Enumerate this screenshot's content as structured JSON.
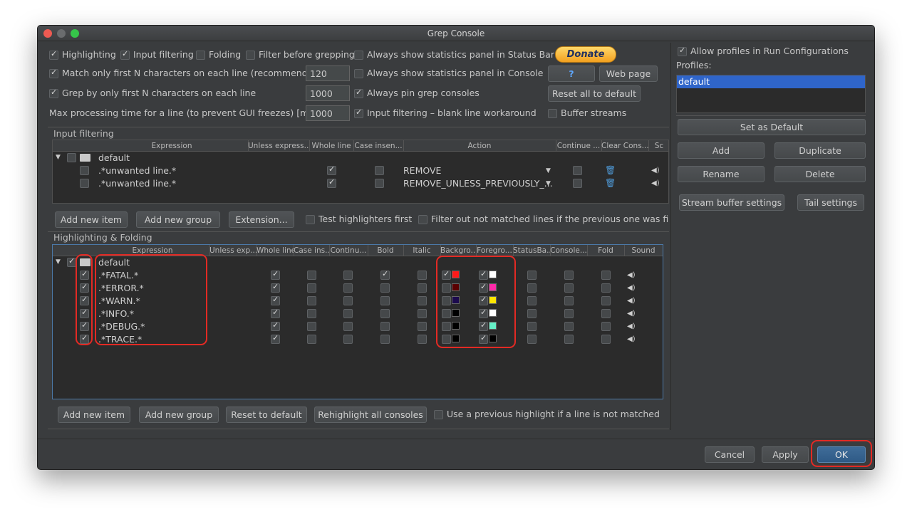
{
  "window": {
    "title": "Grep Console"
  },
  "top_options": {
    "highlighting": {
      "label": "Highlighting",
      "checked": true
    },
    "input_filtering": {
      "label": "Input filtering",
      "checked": true
    },
    "folding": {
      "label": "Folding",
      "checked": false
    },
    "filter_before_grepping": {
      "label": "Filter before grepping",
      "checked": false
    },
    "stats_status_bar": {
      "label": "Always show statistics panel in Status Bar",
      "checked": false
    },
    "match_first_n": {
      "label": "Match only first N characters on each line (recommended)",
      "checked": true,
      "value": "120"
    },
    "stats_console": {
      "label": "Always show statistics panel in Console",
      "checked": false
    },
    "grep_first_n": {
      "label": "Grep by only first N characters on each line",
      "checked": true,
      "value": "1000"
    },
    "pin_consoles": {
      "label": "Always pin grep consoles",
      "checked": true
    },
    "max_processing": {
      "label": "Max processing time for a line (to prevent GUI freezes) [ms]",
      "value": "1000"
    },
    "blank_line_workaround": {
      "label": "Input filtering – blank line workaround",
      "checked": true
    },
    "buffer_streams": {
      "label": "Buffer streams",
      "checked": false
    }
  },
  "buttons": {
    "donate": "Donate",
    "help": "?",
    "web_page": "Web page",
    "reset_all": "Reset all to default"
  },
  "input_filtering": {
    "title": "Input filtering",
    "headers": [
      "Expression",
      "Unless express...",
      "Whole line",
      "Case insen...",
      "Action",
      "Continue ...",
      "Clear Cons...",
      "Sc"
    ],
    "group": "default",
    "rows": [
      {
        "expression": ".*unwanted line.*",
        "whole_line": true,
        "case_insensitive": false,
        "action": "REMOVE",
        "continue": false
      },
      {
        "expression": ".*unwanted line.*",
        "whole_line": true,
        "case_insensitive": false,
        "action": "REMOVE_UNLESS_PREVIOUSLY_...",
        "continue": false
      }
    ],
    "add_item": "Add new item",
    "add_group": "Add new group",
    "extension": "Extension...",
    "test_highlighters": "Test highlighters first",
    "filter_out": "Filter out not matched lines if the previous one was filte"
  },
  "highlighting": {
    "title": "Highlighting & Folding",
    "headers": [
      "Expression",
      "Unless exp...",
      "Whole line",
      "Case ins...",
      "Continu...",
      "Bold",
      "Italic",
      "Backgro...",
      "Foregro...",
      "StatusBa...",
      "Console...",
      "Fold",
      "Sound"
    ],
    "group": "default",
    "rows": [
      {
        "expression": ".*FATAL.*",
        "enabled": true,
        "whole_line": true,
        "bold": true,
        "bg_on": true,
        "bg_color": "#ff1a1a",
        "fg_on": true,
        "fg_color": "#ffffff"
      },
      {
        "expression": ".*ERROR.*",
        "enabled": true,
        "whole_line": true,
        "bold": false,
        "bg_on": false,
        "bg_color": "#5a0000",
        "fg_on": true,
        "fg_color": "#ff2aa8"
      },
      {
        "expression": ".*WARN.*",
        "enabled": true,
        "whole_line": true,
        "bold": false,
        "bg_on": false,
        "bg_color": "#1c0a4e",
        "fg_on": true,
        "fg_color": "#ffe600"
      },
      {
        "expression": ".*INFO.*",
        "enabled": true,
        "whole_line": true,
        "bold": false,
        "bg_on": false,
        "bg_color": "#000000",
        "fg_on": true,
        "fg_color": "#ffffff"
      },
      {
        "expression": ".*DEBUG.*",
        "enabled": true,
        "whole_line": true,
        "bold": false,
        "bg_on": false,
        "bg_color": "#000000",
        "fg_on": true,
        "fg_color": "#66f0c8"
      },
      {
        "expression": ".*TRACE.*",
        "enabled": true,
        "whole_line": true,
        "bold": false,
        "bg_on": false,
        "bg_color": "#000000",
        "fg_on": true,
        "fg_color": "#000000"
      }
    ],
    "add_item": "Add new item",
    "add_group": "Add new group",
    "reset": "Reset to default",
    "rehighlight": "Rehighlight all consoles",
    "use_previous": "Use a previous highlight if a line is not matched"
  },
  "profiles": {
    "allow_label": "Allow profiles in Run Configurations",
    "allow_checked": true,
    "label": "Profiles:",
    "items": [
      "default"
    ],
    "set_default": "Set as Default",
    "add": "Add",
    "duplicate": "Duplicate",
    "rename": "Rename",
    "delete": "Delete",
    "stream_buffer": "Stream buffer settings",
    "tail": "Tail settings"
  },
  "dialog_buttons": {
    "cancel": "Cancel",
    "apply": "Apply",
    "ok": "OK"
  },
  "colors": {
    "annotation": "#e32a24",
    "selection": "#2f65ca",
    "focus_border": "#4b79a8"
  }
}
